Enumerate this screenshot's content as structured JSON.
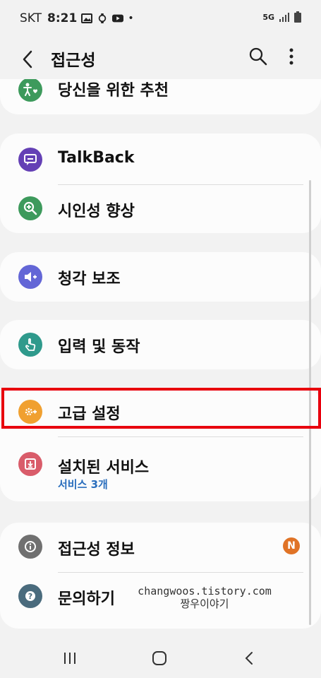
{
  "status_bar": {
    "carrier": "SKT",
    "time": "8:21",
    "network": "5G"
  },
  "header": {
    "title": "접근성"
  },
  "items": {
    "recommended": {
      "label": "당신을 위한 추천",
      "icon": "accessibility-heart-icon",
      "color": "#3d9a5c"
    },
    "talkback": {
      "label": "TalkBack",
      "icon": "chat-icon",
      "color": "#6440b5"
    },
    "visibility": {
      "label": "시인성 향상",
      "icon": "magnify-plus-icon",
      "color": "#3d9a5c"
    },
    "hearing": {
      "label": "청각 보조",
      "icon": "volume-plus-icon",
      "color": "#6366d6"
    },
    "interaction": {
      "label": "입력 및 동작",
      "icon": "touch-hand-icon",
      "color": "#2f9a8c"
    },
    "advanced": {
      "label": "고급 설정",
      "icon": "gear-plus-icon",
      "color": "#f0a030"
    },
    "installed": {
      "label": "설치된 서비스",
      "sublabel": "서비스 3개",
      "icon": "download-icon",
      "color": "#d95c6a"
    },
    "about": {
      "label": "접근성 정보",
      "icon": "info-icon",
      "color": "#707070",
      "badge": "N"
    },
    "contact": {
      "label": "문의하기",
      "icon": "question-icon",
      "color": "#4a6b7d"
    }
  },
  "watermark": {
    "line1": "changwoos.tistory.com",
    "line2": "짱우이야기"
  },
  "highlight_color": "#e8000d"
}
